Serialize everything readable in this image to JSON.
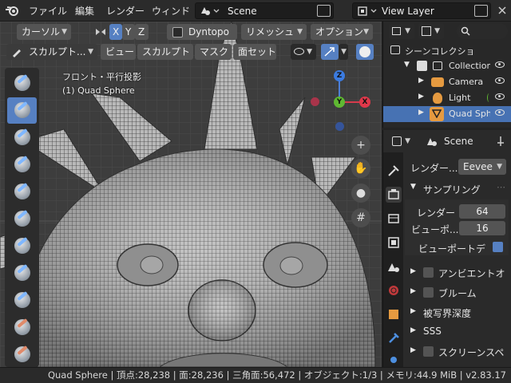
{
  "topbar": {
    "menus": [
      "ファイル",
      "編集",
      "レンダー",
      "ウィンド"
    ],
    "scene": "Scene",
    "view_layer": "View Layer"
  },
  "viewport": {
    "header1": {
      "mode": "カーソル",
      "axes": [
        "X",
        "Y",
        "Z"
      ],
      "dyntopo": "Dyntopo",
      "remesh": "リメッシュ",
      "options": "オプション"
    },
    "header2": {
      "brush": "スカルプト...",
      "menus": [
        "ビュー",
        "スカルプト",
        "マスク",
        "面セット"
      ]
    },
    "overlay": {
      "view_name": "フロント・平行投影",
      "object": "(1) Quad Sphere"
    },
    "gizmo": {
      "z": "Z",
      "y": "Y",
      "x": "X"
    }
  },
  "outliner": {
    "rows": [
      {
        "label": "シーンコレクショ",
        "icon": "collection-icon"
      },
      {
        "label": "Collection",
        "icon": "collection-icon"
      },
      {
        "label": "Camera",
        "icon": "camera-icon"
      },
      {
        "label": "Light",
        "icon": "light-icon"
      },
      {
        "label": "Quad Sphe",
        "icon": "mesh-icon"
      }
    ]
  },
  "properties": {
    "title": "Scene",
    "render_engine_label": "レンダー...",
    "render_engine": "Eevee",
    "sampling_label": "サンプリング",
    "render_label": "レンダー",
    "render_value": "64",
    "viewport_label": "ビューポ...",
    "viewport_value": "16",
    "viewport_denoise_label": "ビューポートデ...",
    "sections": [
      "アンビエントオ",
      "ブルーム",
      "被写界深度",
      "SSS",
      "スクリーンスペ"
    ]
  },
  "statusbar": {
    "text": "Quad Sphere | 頂点:28,238 | 面:28,236 | 三角面:56,472 | オブジェクト:1/3 | メモリ:44.9 MiB | v2.83.17"
  },
  "colors": {
    "accent": "#5680c2",
    "selected": "#4772b3",
    "background": "#3d3d3d"
  }
}
